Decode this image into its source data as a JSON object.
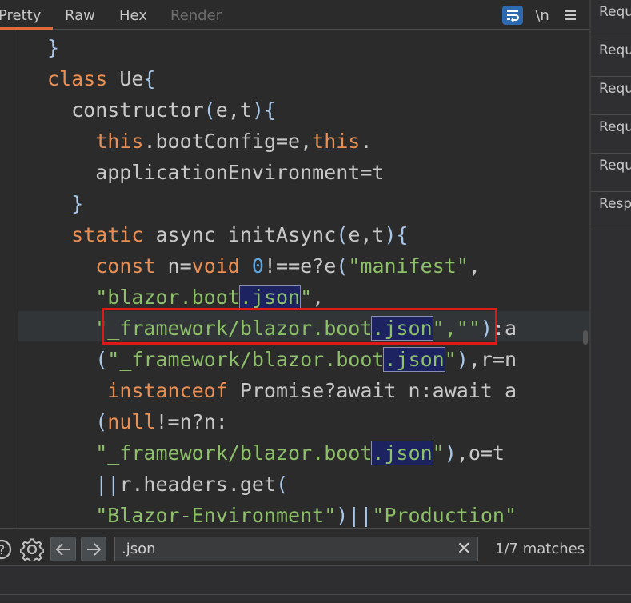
{
  "tabs": [
    {
      "label": "Pretty",
      "active": true
    },
    {
      "label": "Raw",
      "active": false
    },
    {
      "label": "Hex",
      "active": false
    },
    {
      "label": "Render",
      "active": false,
      "disabled": true
    }
  ],
  "toolbar": {
    "wrap_icon": "word-wrap-icon",
    "newline_label": "\\n",
    "menu_icon": "hamburger-menu-icon"
  },
  "side_panel": {
    "items": [
      "Requ",
      "Requ",
      "Requ",
      "Requ",
      "Requ",
      "Resp"
    ]
  },
  "code": {
    "lines": [
      [
        {
          "t": "}",
          "c": "punc"
        }
      ],
      [
        {
          "t": "class",
          "c": "kw"
        },
        {
          "t": " Ue"
        },
        {
          "t": "{",
          "c": "punc"
        }
      ],
      [
        {
          "t": "  constructor"
        },
        {
          "t": "(",
          "c": "punc"
        },
        {
          "t": "e,t"
        },
        {
          "t": "){",
          "c": "punc"
        }
      ],
      [
        {
          "t": "    "
        },
        {
          "t": "this",
          "c": "kw"
        },
        {
          "t": ".bootConfig=e,"
        },
        {
          "t": "this",
          "c": "kw"
        },
        {
          "t": "."
        }
      ],
      [
        {
          "t": "    applicationEnvironment=t"
        }
      ],
      [
        {
          "t": "  "
        },
        {
          "t": "}",
          "c": "punc"
        }
      ],
      [
        {
          "t": "  "
        },
        {
          "t": "static",
          "c": "kw"
        },
        {
          "t": " async initAsync"
        },
        {
          "t": "(",
          "c": "punc"
        },
        {
          "t": "e,t"
        },
        {
          "t": "){",
          "c": "punc"
        }
      ],
      [
        {
          "t": "    "
        },
        {
          "t": "const",
          "c": "kw"
        },
        {
          "t": " n="
        },
        {
          "t": "void",
          "c": "kw"
        },
        {
          "t": " "
        },
        {
          "t": "0",
          "c": "num"
        },
        {
          "t": "!==e?e"
        },
        {
          "t": "(",
          "c": "punc"
        },
        {
          "t": "\"manifest\"",
          "c": "str"
        },
        {
          "t": ","
        }
      ],
      [
        {
          "t": "    "
        },
        {
          "t": "\"blazor.boot",
          "c": "str"
        },
        {
          "t": ".json",
          "c": "str hl"
        },
        {
          "t": "\"",
          "c": "str"
        },
        {
          "t": ","
        }
      ],
      [
        {
          "t": "    "
        },
        {
          "t": "\"_framework/blazor.boot",
          "c": "str"
        },
        {
          "t": ".json",
          "c": "str hl"
        },
        {
          "t": "\"",
          "c": "str"
        },
        {
          "t": ",\"\"",
          "c": "str"
        },
        {
          "t": ")",
          "c": "punc"
        },
        {
          "t": ":a"
        }
      ],
      [
        {
          "t": "    "
        },
        {
          "t": "(",
          "c": "punc"
        },
        {
          "t": "\"_framework/blazor.boot",
          "c": "str"
        },
        {
          "t": ".json",
          "c": "str hl"
        },
        {
          "t": "\"",
          "c": "str"
        },
        {
          "t": ")",
          "c": "punc"
        },
        {
          "t": ",r=n"
        }
      ],
      [
        {
          "t": "     "
        },
        {
          "t": "instanceof",
          "c": "kw"
        },
        {
          "t": " Promise?await n:await a"
        }
      ],
      [
        {
          "t": "    "
        },
        {
          "t": "(",
          "c": "punc"
        },
        {
          "t": "null",
          "c": "kw"
        },
        {
          "t": "!=n?n:"
        }
      ],
      [
        {
          "t": "    "
        },
        {
          "t": "\"_framework/blazor.boot",
          "c": "str"
        },
        {
          "t": ".json",
          "c": "str hl"
        },
        {
          "t": "\"",
          "c": "str"
        },
        {
          "t": ")",
          "c": "punc"
        },
        {
          "t": ",o=t"
        }
      ],
      [
        {
          "t": "    "
        },
        {
          "t": "||",
          "c": "punc"
        },
        {
          "t": "r.headers.get"
        },
        {
          "t": "(",
          "c": "punc"
        }
      ],
      [
        {
          "t": "    "
        },
        {
          "t": "\"Blazor-Environment\"",
          "c": "str"
        },
        {
          "t": ")||",
          "c": "punc"
        },
        {
          "t": "\"Production\"",
          "c": "str"
        }
      ]
    ],
    "current_line_index": 9
  },
  "search": {
    "help_icon": "help-icon",
    "settings_icon": "gear-icon",
    "prev_icon": "arrow-left-icon",
    "next_icon": "arrow-right-icon",
    "query": ".json",
    "clear_icon": "clear-icon",
    "match_status": "1/7 matches"
  },
  "colors": {
    "accent": "#e06c3b",
    "keyword": "#e98f54",
    "string": "#8ec06a",
    "number": "#5fa7e0",
    "highlight_bg": "#1c2360",
    "annotation_box": "#e01818",
    "wrap_button": "#2d6ab0"
  }
}
